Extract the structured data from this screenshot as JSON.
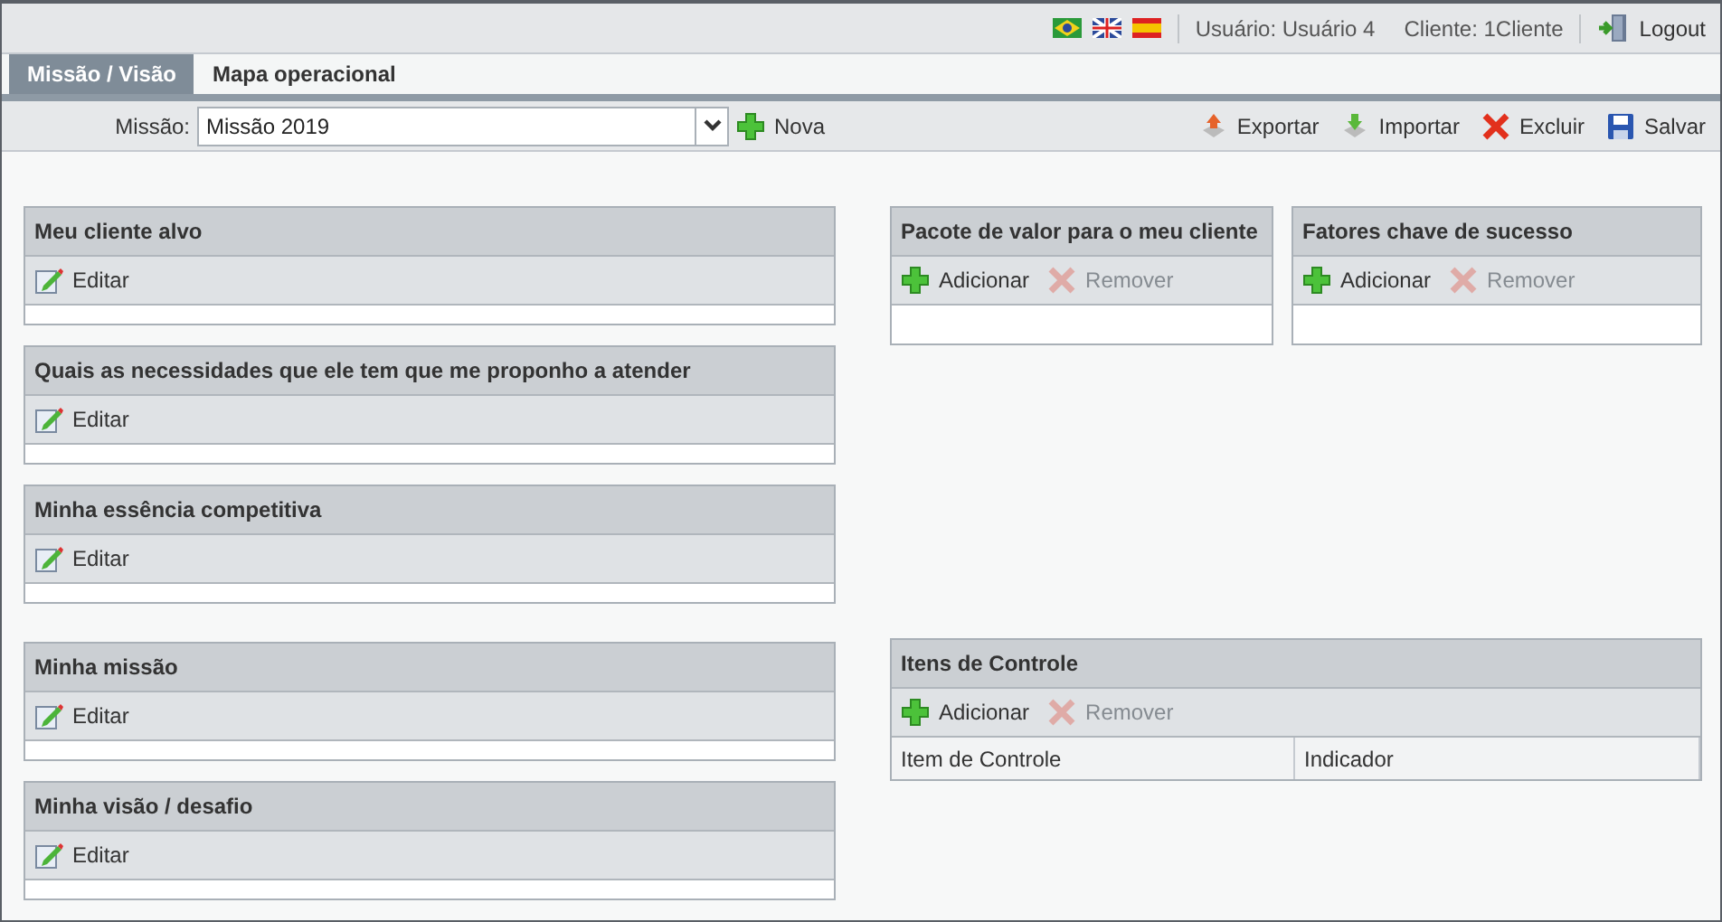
{
  "top_bar": {
    "flags": [
      {
        "kind": "br"
      },
      {
        "kind": "uk"
      },
      {
        "kind": "es"
      }
    ],
    "user": "Usuário: Usuário 4",
    "client": "Cliente: 1Cliente",
    "logout": "Logout"
  },
  "tabs": [
    {
      "label": "Missão / Visão",
      "selected": true
    },
    {
      "label": "Mapa operacional",
      "selected": false
    }
  ],
  "toolbar": {
    "mission_label": "Missão:",
    "mission_value": "Missão 2019",
    "new_button": "Nova",
    "actions": [
      {
        "kind": "export",
        "label": "Exportar"
      },
      {
        "kind": "import",
        "label": "Importar"
      },
      {
        "kind": "delete",
        "label": "Excluir"
      },
      {
        "kind": "save",
        "label": "Salvar"
      }
    ]
  },
  "left_groups": [
    [
      {
        "title": "Meu cliente alvo",
        "actions": [
          {
            "kind": "edit",
            "label": "Editar",
            "disabled": false
          }
        ]
      },
      {
        "title": "Quais as necessidades que ele tem que me proponho a atender",
        "actions": [
          {
            "kind": "edit",
            "label": "Editar",
            "disabled": false
          }
        ]
      },
      {
        "title": "Minha essência competitiva",
        "actions": [
          {
            "kind": "edit",
            "label": "Editar",
            "disabled": false
          }
        ]
      }
    ],
    [
      {
        "title": "Minha missão",
        "actions": [
          {
            "kind": "edit",
            "label": "Editar",
            "disabled": false
          }
        ]
      },
      {
        "title": "Minha visão / desafio",
        "actions": [
          {
            "kind": "edit",
            "label": "Editar",
            "disabled": false
          }
        ]
      }
    ]
  ],
  "right_panels": [
    {
      "title": "Pacote de valor para o meu cliente",
      "actions": [
        {
          "kind": "add",
          "label": "Adicionar",
          "disabled": false
        },
        {
          "kind": "remove",
          "label": "Remover",
          "disabled": true
        }
      ]
    },
    {
      "title": "Fatores chave de sucesso",
      "actions": [
        {
          "kind": "add",
          "label": "Adicionar",
          "disabled": false
        },
        {
          "kind": "remove",
          "label": "Remover",
          "disabled": true
        }
      ]
    }
  ],
  "control_panel": {
    "title": "Itens de Controle",
    "actions": [
      {
        "kind": "add",
        "label": "Adicionar",
        "disabled": false
      },
      {
        "kind": "remove",
        "label": "Remover",
        "disabled": true
      }
    ],
    "columns": [
      "Item de Controle",
      "Indicador"
    ]
  }
}
